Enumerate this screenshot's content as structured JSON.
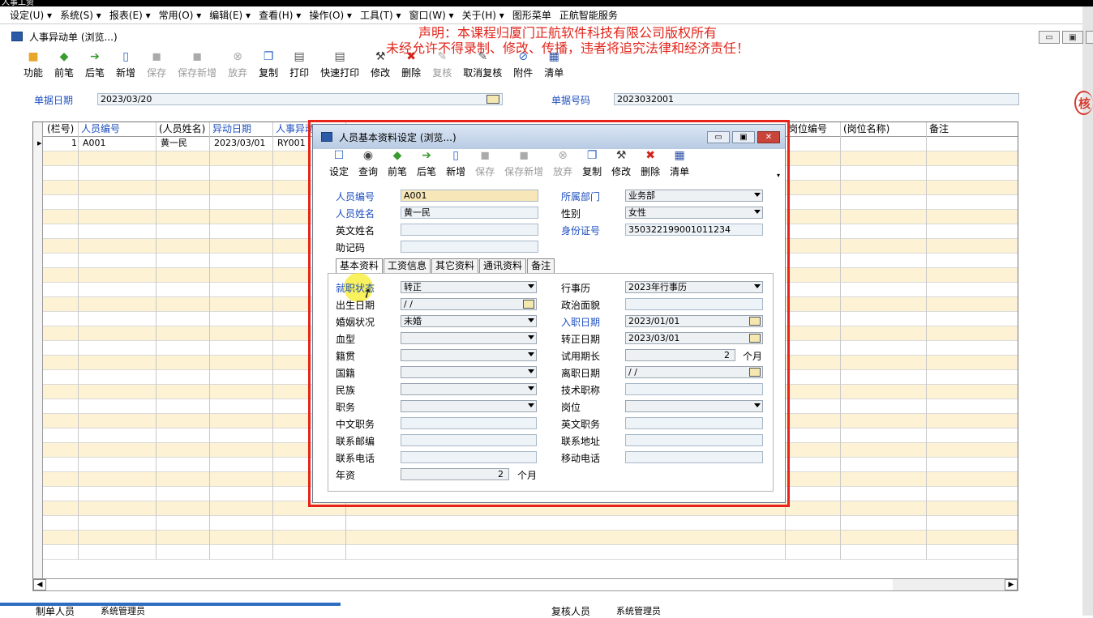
{
  "titlebar_text": "人事工资",
  "menu": [
    "设定(U)",
    "系统(S)",
    "报表(E)",
    "常用(O)",
    "编辑(E)",
    "查看(H)",
    "操作(O)",
    "工具(T)",
    "窗口(W)",
    "关于(H)",
    "图形菜单",
    "正航智能服务"
  ],
  "window": {
    "title": "人事异动单 (浏览...)",
    "min": "▭",
    "max": "▣",
    "close": "✕"
  },
  "notice": {
    "line1": "声明：本课程归厦门正航软件科技有限公司版权所有",
    "line2": "未经允许不得录制、修改、传播，违者将追究法律和经济责任！"
  },
  "toolbar": [
    {
      "label": "功能",
      "icon": "box-icon",
      "enabled": true
    },
    {
      "label": "前笔",
      "icon": "arrow-left-icon",
      "enabled": true
    },
    {
      "label": "后笔",
      "icon": "arrow-right-icon",
      "enabled": true
    },
    {
      "label": "新增",
      "icon": "new-doc-icon",
      "enabled": true
    },
    {
      "label": "保存",
      "icon": "save-icon",
      "enabled": false
    },
    {
      "label": "保存新增",
      "icon": "save-new-icon",
      "enabled": false
    },
    {
      "label": "放弃",
      "icon": "cancel-icon",
      "enabled": false
    },
    {
      "label": "复制",
      "icon": "copy-icon",
      "enabled": true
    },
    {
      "label": "打印",
      "icon": "print-icon",
      "enabled": true
    },
    {
      "label": "快速打印",
      "icon": "quick-print-icon",
      "enabled": true
    },
    {
      "label": "修改",
      "icon": "hammer-icon",
      "enabled": true
    },
    {
      "label": "删除",
      "icon": "delete-icon",
      "enabled": true
    },
    {
      "label": "复核",
      "icon": "review-icon",
      "enabled": false
    },
    {
      "label": "取消复核",
      "icon": "unreview-icon",
      "enabled": true
    },
    {
      "label": "附件",
      "icon": "attach-icon",
      "enabled": true
    },
    {
      "label": "清单",
      "icon": "list-icon",
      "enabled": true
    }
  ],
  "header": {
    "date_label": "单据日期",
    "date_value": "2023/03/20",
    "no_label": "单据号码",
    "no_value": "2023032001"
  },
  "grid": {
    "columns": [
      "(栏号)",
      "人员编号",
      "(人员姓名)",
      "异动日期",
      "人事异动",
      "岗位编号",
      "(岗位名称)",
      "备注"
    ],
    "rows": [
      {
        "no": "1",
        "emp_no": "A001",
        "emp_name": "黄一民",
        "date": "2023/03/01",
        "change": "RY001"
      }
    ],
    "row_marker": "▸"
  },
  "footer": {
    "maker_label": "制单人员",
    "maker_value": "系统管理员",
    "reviewer_label": "复核人员",
    "reviewer_value": "系统管理员"
  },
  "stamp": "核",
  "dialog": {
    "title": "人员基本资料设定 (浏览...)",
    "toolbar": [
      {
        "label": "设定",
        "icon": "setting-icon",
        "enabled": true
      },
      {
        "label": "查询",
        "icon": "search-icon",
        "enabled": true
      },
      {
        "label": "前笔",
        "icon": "arrow-left-icon",
        "enabled": true
      },
      {
        "label": "后笔",
        "icon": "arrow-right-icon",
        "enabled": true
      },
      {
        "label": "新增",
        "icon": "new-doc-icon",
        "enabled": true
      },
      {
        "label": "保存",
        "icon": "save-icon",
        "enabled": false
      },
      {
        "label": "保存新增",
        "icon": "save-new-icon",
        "enabled": false
      },
      {
        "label": "放弃",
        "icon": "cancel-icon",
        "enabled": false
      },
      {
        "label": "复制",
        "icon": "copy-icon",
        "enabled": true
      },
      {
        "label": "修改",
        "icon": "hammer-icon",
        "enabled": true
      },
      {
        "label": "删除",
        "icon": "delete-icon",
        "enabled": true
      },
      {
        "label": "清单",
        "icon": "list-icon",
        "enabled": true
      }
    ],
    "top": {
      "emp_no_label": "人员编号",
      "emp_no": "A001",
      "dept_label": "所属部门",
      "dept": "业务部",
      "name_label": "人员姓名",
      "name": "黄一民",
      "gender_label": "性别",
      "gender": "女性",
      "en_name_label": "英文姓名",
      "en_name": "",
      "id_label": "身份证号",
      "id": "350322199001011234",
      "mnemonic_label": "助记码",
      "mnemonic": ""
    },
    "tabs": [
      "基本资料",
      "工资信息",
      "其它资料",
      "通讯资料",
      "备注"
    ],
    "left_fields": [
      {
        "label": "就职状态",
        "value": "转正",
        "type": "combo",
        "blue": true
      },
      {
        "label": "出生日期",
        "value": "  /  /",
        "type": "date",
        "blue": false
      },
      {
        "label": "婚姻状况",
        "value": "未婚",
        "type": "combo",
        "blue": false
      },
      {
        "label": "血型",
        "value": "",
        "type": "combo",
        "blue": false
      },
      {
        "label": "籍贯",
        "value": "",
        "type": "combo",
        "blue": false
      },
      {
        "label": "国籍",
        "value": "",
        "type": "combo",
        "blue": false
      },
      {
        "label": "民族",
        "value": "",
        "type": "combo",
        "blue": false
      },
      {
        "label": "职务",
        "value": "",
        "type": "combo",
        "blue": false
      },
      {
        "label": "中文职务",
        "value": "",
        "type": "text",
        "blue": false
      },
      {
        "label": "联系邮编",
        "value": "",
        "type": "text",
        "blue": false
      },
      {
        "label": "联系电话",
        "value": "",
        "type": "text",
        "blue": false
      },
      {
        "label": "年资",
        "value": "2",
        "type": "num",
        "unit": "个月",
        "blue": false
      }
    ],
    "right_fields": [
      {
        "label": "行事历",
        "value": "2023年行事历",
        "type": "combo",
        "blue": false
      },
      {
        "label": "政治面貌",
        "value": "",
        "type": "text",
        "blue": false
      },
      {
        "label": "入职日期",
        "value": "2023/01/01",
        "type": "date2",
        "blue": true
      },
      {
        "label": "转正日期",
        "value": "2023/03/01",
        "type": "date2",
        "blue": false
      },
      {
        "label": "试用期长",
        "value": "2",
        "type": "num",
        "unit": "个月",
        "blue": false
      },
      {
        "label": "离职日期",
        "value": "  /  /",
        "type": "date",
        "blue": false
      },
      {
        "label": "技术职称",
        "value": "",
        "type": "text",
        "blue": false
      },
      {
        "label": "岗位",
        "value": "",
        "type": "combo",
        "blue": false
      },
      {
        "label": "英文职务",
        "value": "",
        "type": "text",
        "blue": false
      },
      {
        "label": "联系地址",
        "value": "",
        "type": "text",
        "blue": false
      },
      {
        "label": "移动电话",
        "value": "",
        "type": "text",
        "blue": false
      }
    ]
  }
}
